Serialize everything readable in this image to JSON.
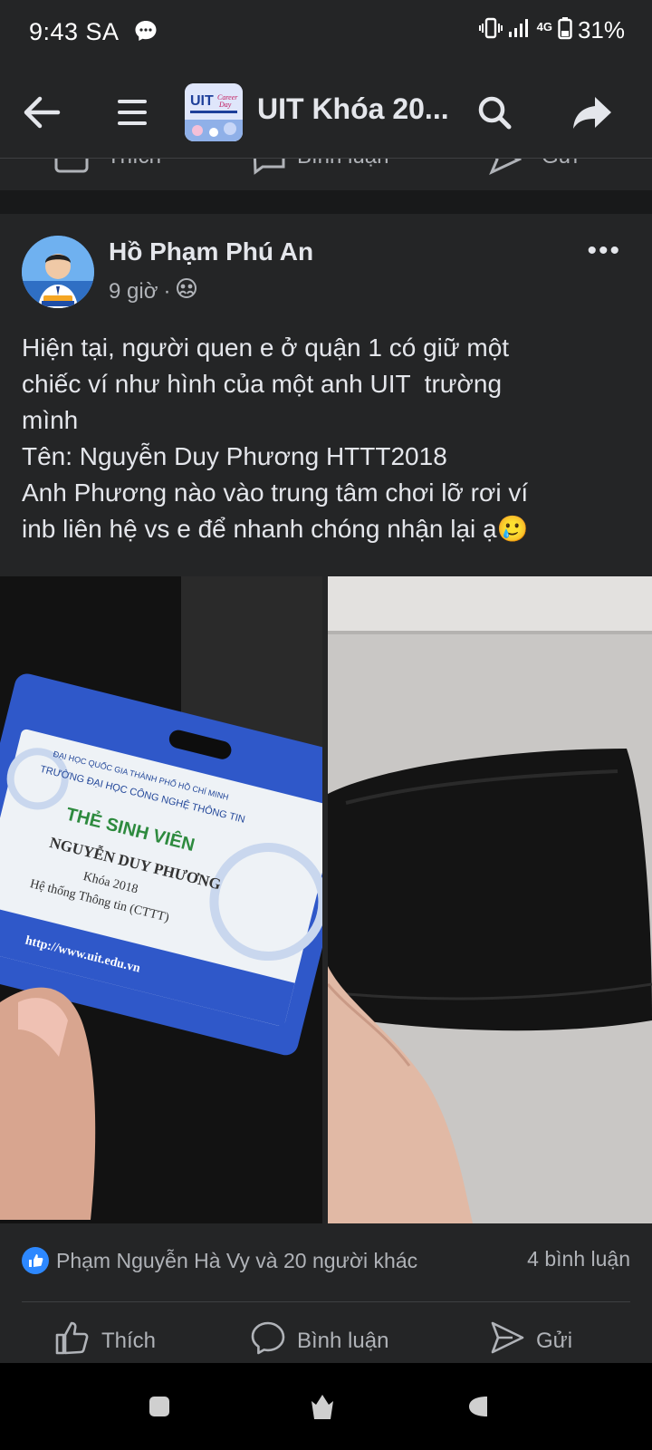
{
  "status_bar": {
    "time": "9:43 SA",
    "network": "4G",
    "battery": "31%"
  },
  "header": {
    "group_name": "UIT Khóa 20...",
    "icons": [
      "back-arrow-icon",
      "menu-icon",
      "search-icon",
      "share-icon"
    ]
  },
  "previous_post_actions": {
    "like": "Thích",
    "comment": "Bình luận",
    "send": "Gửi"
  },
  "post": {
    "author": "Hồ Phạm Phú An",
    "time": "9 giờ",
    "audience_icon": "group-audience-icon",
    "text_lines": [
      "Hiện tại, người quen e ở quận 1 có giữ một",
      "chiếc ví như hình của một anh UIT  trường",
      "mình",
      "Tên: Nguyễn Duy Phương HTTT2018",
      "Anh Phương nào vào trung tâm chơi lỡ rơi ví",
      "inb liên hệ vs e để nhanh chóng nhận lại ạ🥲"
    ],
    "photo_card": {
      "line1": "ĐẠI HỌC QUỐC GIA THÀNH PHỐ HỒ CHÍ MINH",
      "line2": "TRƯỜNG ĐẠI HỌC CÔNG NGHỆ THÔNG TIN",
      "title": "THẺ SINH VIÊN",
      "name": "NGUYỄN DUY PHƯƠNG",
      "course": "Khóa 2018",
      "major": "Hệ thống Thông tin (CTTT)",
      "url": "http://www.uit.edu.vn"
    },
    "reactions_text": "Phạm Nguyễn Hà Vy và 20 người khác",
    "comments_text": "4 bình luận",
    "actions": {
      "like": "Thích",
      "comment": "Bình luận",
      "send": "Gửi"
    }
  },
  "colors": {
    "background": "#18191a",
    "card": "#242526",
    "text": "#e4e6eb",
    "secondary_text": "#b0b3b8",
    "like_blue": "#2d88ff"
  }
}
